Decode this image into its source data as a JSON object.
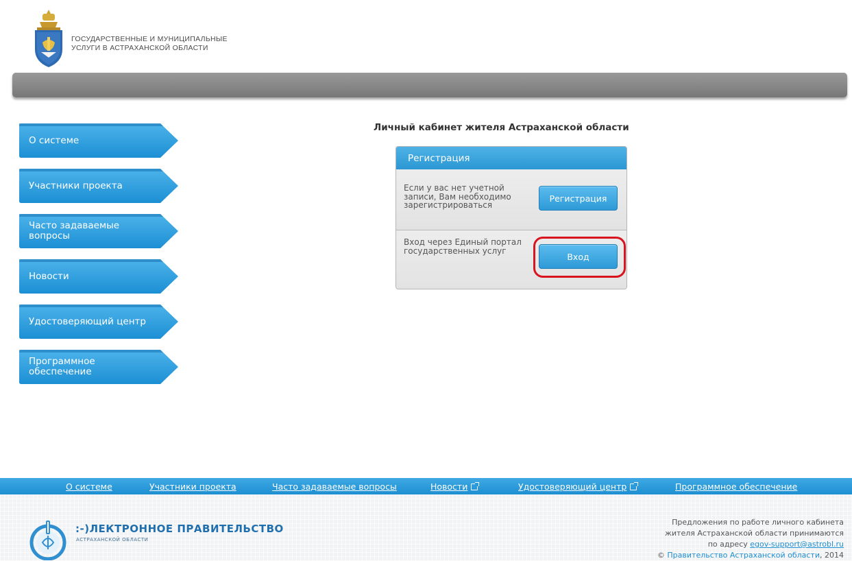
{
  "header": {
    "org_line1": "Государственные и муниципальные",
    "org_line2": "услуги в Астраханской области"
  },
  "sidebar": {
    "items": [
      {
        "label": "О системе"
      },
      {
        "label": "Участники проекта"
      },
      {
        "label": "Часто задаваемые вопросы"
      },
      {
        "label": "Новости"
      },
      {
        "label": "Удостоверяющий центр"
      },
      {
        "label": "Программное обеспечение"
      }
    ]
  },
  "main": {
    "title": "Личный кабинет жителя Астраханской области",
    "panel_header": "Регистрация",
    "registration_text": "Если у вас нет учетной записи, Вам необходимо зарегистрироваться",
    "registration_button": "Регистрация",
    "login_text": "Вход через Единый портал государственных услуг",
    "login_button": "Вход"
  },
  "footer": {
    "links": [
      {
        "label": "О системе",
        "external": false
      },
      {
        "label": "Участники проекта",
        "external": false
      },
      {
        "label": "Часто задаваемые вопросы",
        "external": false
      },
      {
        "label": "Новости",
        "external": true
      },
      {
        "label": "Удостоверяющий центр",
        "external": true
      },
      {
        "label": "Программное обеспечение",
        "external": false
      }
    ],
    "egov_title": ":-)ЛЕКТРОННОЕ ПРАВИТЕЛЬСТВО",
    "egov_subtitle": "АСТРАХАНСКОЙ ОБЛАСТИ",
    "info_line1": "Предложения по работе личного кабинета",
    "info_line2": "жителя Астраханской области принимаются",
    "info_prefix": "по адресу",
    "email": "egov-support@astrobl.ru",
    "copyright_symbol": "©",
    "copyright_link": "Правительство Астраханской области",
    "copyright_year": ", 2014"
  },
  "colors": {
    "accent": "#2b97d3",
    "highlight": "#d8141e",
    "header_bar": "#8a8a8a"
  },
  "icons": [
    "coat-of-arms-icon",
    "external-link-icon",
    "egov-logo-icon"
  ]
}
